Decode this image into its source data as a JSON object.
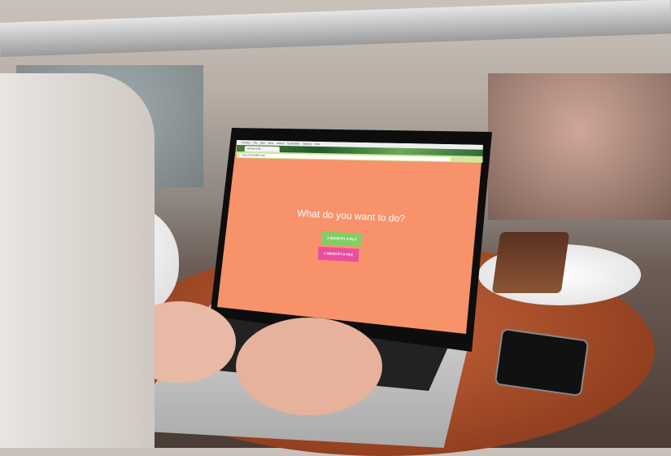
{
  "browser": {
    "menu": [
      "Chrome",
      "File",
      "Edit",
      "View",
      "History",
      "Bookmarks",
      "Window",
      "Help"
    ],
    "tab_title": "encrypt a file",
    "url": "www.encryptafile.app"
  },
  "page": {
    "question": "What do you want to do?",
    "encrypt_label": "ENCRYPT A FILE",
    "decrypt_label": "DECRYPT A FILE",
    "encrypt_icon": "key-icon",
    "decrypt_icon": "unlock-icon"
  },
  "colors": {
    "background": "#f7926b",
    "encrypt": "#7fcf66",
    "decrypt": "#e84fa0"
  }
}
